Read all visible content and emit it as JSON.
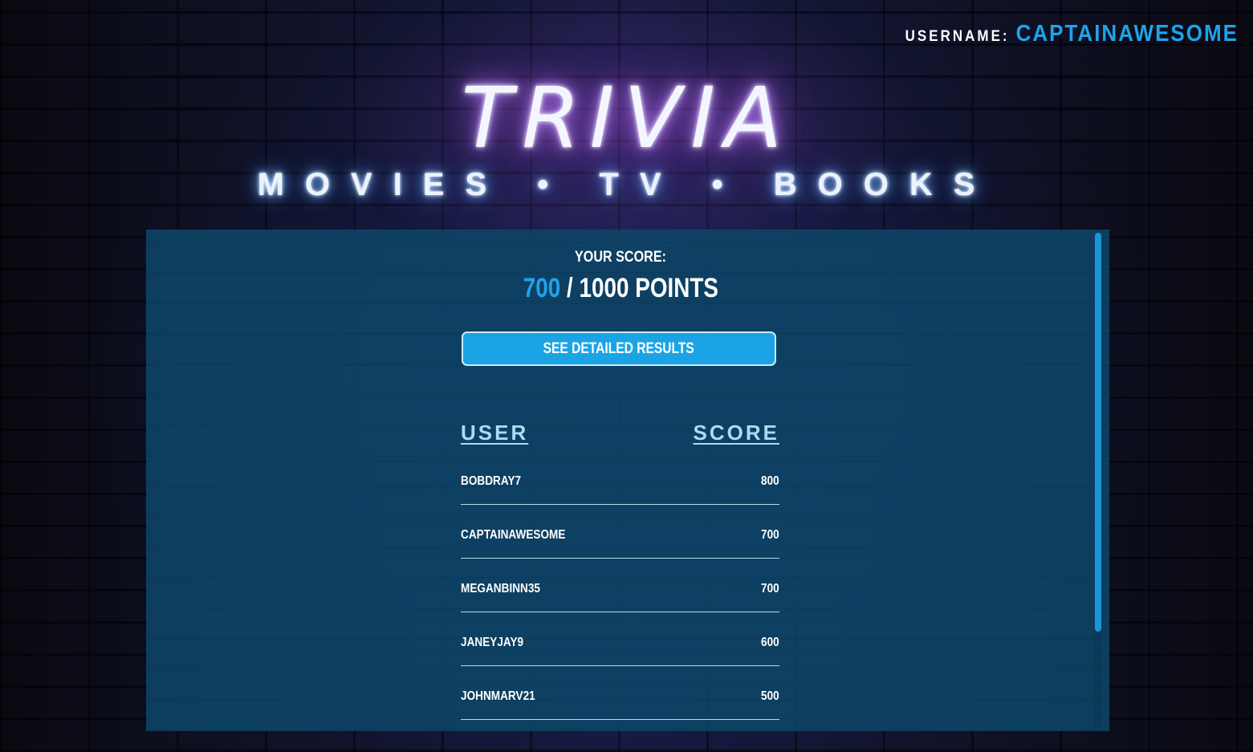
{
  "header": {
    "username_label": "USERNAME:",
    "username": "CAPTAINAWESOME",
    "logo_text": "TRIVIA",
    "subtitle": "MOVIES • TV • BOOKS"
  },
  "results": {
    "score_label": "YOUR SCORE:",
    "score": "700",
    "score_total": "/ 1000 POINTS",
    "detail_button": "SEE DETAILED RESULTS"
  },
  "leaderboard": {
    "columns": [
      "USER",
      "SCORE"
    ],
    "rows": [
      {
        "user": "BOBDRAY7",
        "score": "800"
      },
      {
        "user": "CAPTAINAWESOME",
        "score": "700"
      },
      {
        "user": "MEGANBINN35",
        "score": "700"
      },
      {
        "user": "JANEYJAY9",
        "score": "600"
      },
      {
        "user": "JOHNMARV21",
        "score": "500"
      }
    ]
  },
  "colors": {
    "accent": "#1fa3ea",
    "panel": "#0e4668",
    "button": "#1aa4e6",
    "neon_glow": "#a05bd8"
  }
}
